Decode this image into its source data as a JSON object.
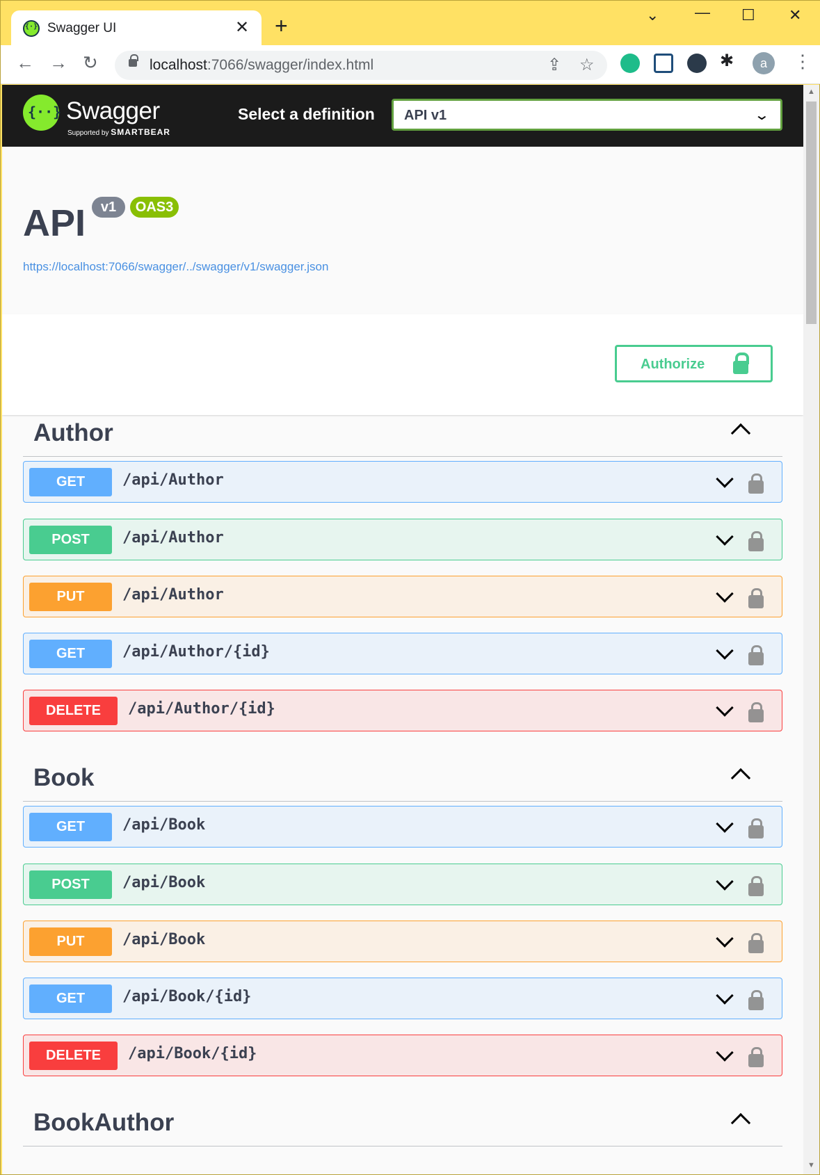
{
  "browser": {
    "tab_title": "Swagger UI",
    "url_host": "localhost",
    "url_rest": ":7066/swagger/index.html",
    "avatar_letter": "a"
  },
  "topbar": {
    "logo_text": "Swagger",
    "logo_sub_prefix": "Supported by",
    "logo_sub_brand": "SMARTBEAR",
    "select_label": "Select a definition",
    "select_value": "API v1"
  },
  "info": {
    "title": "API",
    "version_badge": "v1",
    "oas_badge": "OAS3",
    "spec_url": "https://localhost:7066/swagger/../swagger/v1/swagger.json"
  },
  "authorize": {
    "label": "Authorize"
  },
  "colors": {
    "get": "#61affe",
    "post": "#49cc90",
    "put": "#fca130",
    "delete": "#f93e3e",
    "authorize": "#49cc90"
  },
  "tags": [
    {
      "name": "Author",
      "operations": [
        {
          "method": "GET",
          "path": "/api/Author"
        },
        {
          "method": "POST",
          "path": "/api/Author"
        },
        {
          "method": "PUT",
          "path": "/api/Author"
        },
        {
          "method": "GET",
          "path": "/api/Author/{id}"
        },
        {
          "method": "DELETE",
          "path": "/api/Author/{id}"
        }
      ]
    },
    {
      "name": "Book",
      "operations": [
        {
          "method": "GET",
          "path": "/api/Book"
        },
        {
          "method": "POST",
          "path": "/api/Book"
        },
        {
          "method": "PUT",
          "path": "/api/Book"
        },
        {
          "method": "GET",
          "path": "/api/Book/{id}"
        },
        {
          "method": "DELETE",
          "path": "/api/Book/{id}"
        }
      ]
    },
    {
      "name": "BookAuthor",
      "operations": []
    }
  ]
}
